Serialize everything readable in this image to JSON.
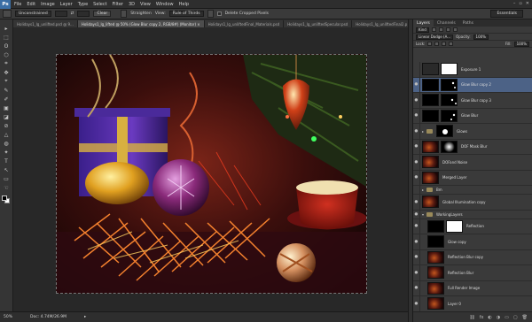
{
  "app": {
    "logo": "Ps"
  },
  "menu": [
    "File",
    "Edit",
    "Image",
    "Layer",
    "Type",
    "Select",
    "Filter",
    "3D",
    "View",
    "Window",
    "Help"
  ],
  "window_controls": [
    "–",
    "▫",
    "✕"
  ],
  "options": {
    "ratio": "Unconstrained",
    "swap": "⇄",
    "clear": "Clear",
    "straighten": "Straighten",
    "view_label": "View:",
    "view_value": "Rule of Thirds",
    "delete_cropped": "Delete Cropped Pixels",
    "workspace": "Essentials"
  },
  "tabs": [
    "Holidays1_lg_unlifted.psd @ 9...",
    "Holidays1_lg_lifted @ 50% (Glow Blur copy 2, RGB/8#) (Monitor) ×",
    "Holidays1_lg_unliftedFinal_Materials.psd",
    "Holidays1_lg_unliftedSpecular.psd",
    "Holidays1_lg_unliftedFinal2.p"
  ],
  "tools": [
    "▸",
    "⬚",
    "ʘ",
    "⬡",
    "⌗",
    "✥",
    "⌖",
    "✎",
    "✐",
    "▣",
    "◪",
    "⊘",
    "△",
    "◍",
    "✦",
    "T",
    "↖",
    "▭",
    "☜",
    "⚲"
  ],
  "status": {
    "zoom": "50%",
    "doc": "Doc: 4.74M/26.9M",
    "arrow": "▸"
  },
  "panels": {
    "tabs": [
      "Layers",
      "Channels",
      "Paths"
    ],
    "kind": "Kind",
    "blend": "Linear Dodge (A...",
    "opacity_label": "Opacity:",
    "opacity": "100%",
    "lock_label": "Lock:",
    "fill_label": "Fill:",
    "fill": "100%"
  },
  "layers": [
    {
      "name": "Exposure 1",
      "eye": "",
      "type": "adj",
      "mask": "white"
    },
    {
      "name": "Glow Blur copy 2",
      "eye": "●",
      "type": "black",
      "mask": "dots",
      "selected": true
    },
    {
      "name": "Glow Blur copy 3",
      "eye": "●",
      "type": "black",
      "mask": "dots"
    },
    {
      "name": "Glow Blur",
      "eye": "●",
      "type": "black",
      "mask": "dots"
    },
    {
      "name": "Glows",
      "eye": "●",
      "type": "group"
    },
    {
      "name": "DOF Mask Blur",
      "eye": "●",
      "type": "photo",
      "mask": "blur"
    },
    {
      "name": "DOFand Noise",
      "eye": "●",
      "type": "photo"
    },
    {
      "name": "Merged Layer",
      "eye": "●",
      "type": "photo"
    },
    {
      "name": "Bm",
      "eye": "",
      "type": "group"
    },
    {
      "name": "Global Illumination copy",
      "eye": "●",
      "type": "photo"
    },
    {
      "name": "WorkingLayers",
      "eye": "●",
      "type": "group"
    },
    {
      "name": "Reflection",
      "eye": "●",
      "type": "black",
      "mask": "white"
    },
    {
      "name": "Glow copy",
      "eye": "●",
      "type": "black"
    },
    {
      "name": "Reflection Blur copy",
      "eye": "●",
      "type": "photo"
    },
    {
      "name": "Reflection Blur",
      "eye": "●",
      "type": "photo"
    },
    {
      "name": "Full Render Image",
      "eye": "●",
      "type": "photo"
    },
    {
      "name": "Layer 0",
      "eye": "●",
      "type": "photo"
    }
  ],
  "footer_icons": [
    "⛓",
    "fx",
    "◐",
    "◑",
    "▭",
    "▢",
    "🗑"
  ]
}
